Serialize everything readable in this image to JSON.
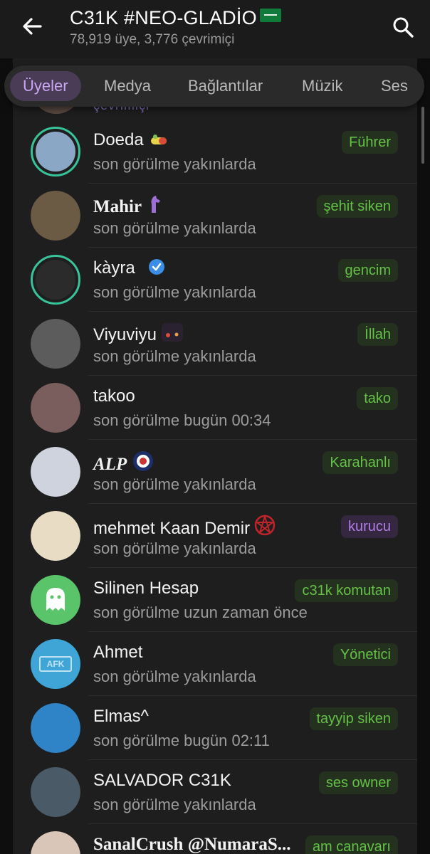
{
  "header": {
    "title": "C31K #NEO-GLADİO",
    "subtitle": "78,919 üye, 3,776 çevrimiçi"
  },
  "tabs": [
    {
      "label": "Üyeler",
      "active": true
    },
    {
      "label": "Medya",
      "active": false
    },
    {
      "label": "Bağlantılar",
      "active": false
    },
    {
      "label": "Müzik",
      "active": false
    },
    {
      "label": "Ses",
      "active": false
    }
  ],
  "members": [
    {
      "name": "Doeda",
      "status": "son görülme yakınlarda",
      "badge": "Führer",
      "badge_color": "green",
      "avatar_color": "#8aa7c6",
      "icon": "pill-icon"
    },
    {
      "name": "Mahir",
      "status": "son görülme yakınlarda",
      "badge": "şehit siken",
      "badge_color": "green",
      "avatar_color": "#6b5a44",
      "icon": "horse-icon"
    },
    {
      "name": "kàyra",
      "status": "son görülme yakınlarda",
      "badge": "gencim",
      "badge_color": "green",
      "avatar_color": "#2b2b2b",
      "icon": "verified-icon"
    },
    {
      "name": "Viyuviyu",
      "status": "son görülme yakınlarda",
      "badge": "İllah",
      "badge_color": "green",
      "avatar_color": "#5c5c5c",
      "icon": "photo-icon"
    },
    {
      "name": "takoo",
      "status": "son görülme bugün 00:34",
      "badge": "tako",
      "badge_color": "green",
      "avatar_color": "#7a5d5d"
    },
    {
      "name": "ALP",
      "status": "son görülme yakınlarda",
      "badge": "Karahanlı",
      "badge_color": "green",
      "avatar_color": "#cfd3de",
      "icon": "emblem-icon"
    },
    {
      "name": "mehmet Kaan Demir",
      "status": "son görülme yakınlarda",
      "badge": "kurucu",
      "badge_color": "purple",
      "avatar_color": "#e8dcc4",
      "icon": "pentagram-icon"
    },
    {
      "name": "Silinen Hesap",
      "status": "son görülme uzun zaman önce",
      "badge": "c31k komutan",
      "badge_color": "green",
      "avatar_color": "#5ac46a",
      "icon": "ghost-icon"
    },
    {
      "name": "Ahmet",
      "status": "son görülme yakınlarda",
      "badge": "Yönetici",
      "badge_color": "green",
      "avatar_color": "#3fa5d6",
      "icon": "afk-icon",
      "avatar_text": "AFK"
    },
    {
      "name": "Elmas^",
      "status": "son görülme bugün 02:11",
      "badge": "tayyip siken",
      "badge_color": "green",
      "avatar_color": "#2f83c7"
    },
    {
      "name": "SALVADOR C31K",
      "status": "son görülme yakınlarda",
      "badge": "ses owner",
      "badge_color": "green",
      "avatar_color": "#4a5a66"
    },
    {
      "name": "SanalCrush @NumaraS...",
      "status": "",
      "badge": "am canavarı",
      "badge_color": "green",
      "avatar_color": "#d9c6b8"
    }
  ],
  "partial_row_status": "çevrimiçi"
}
